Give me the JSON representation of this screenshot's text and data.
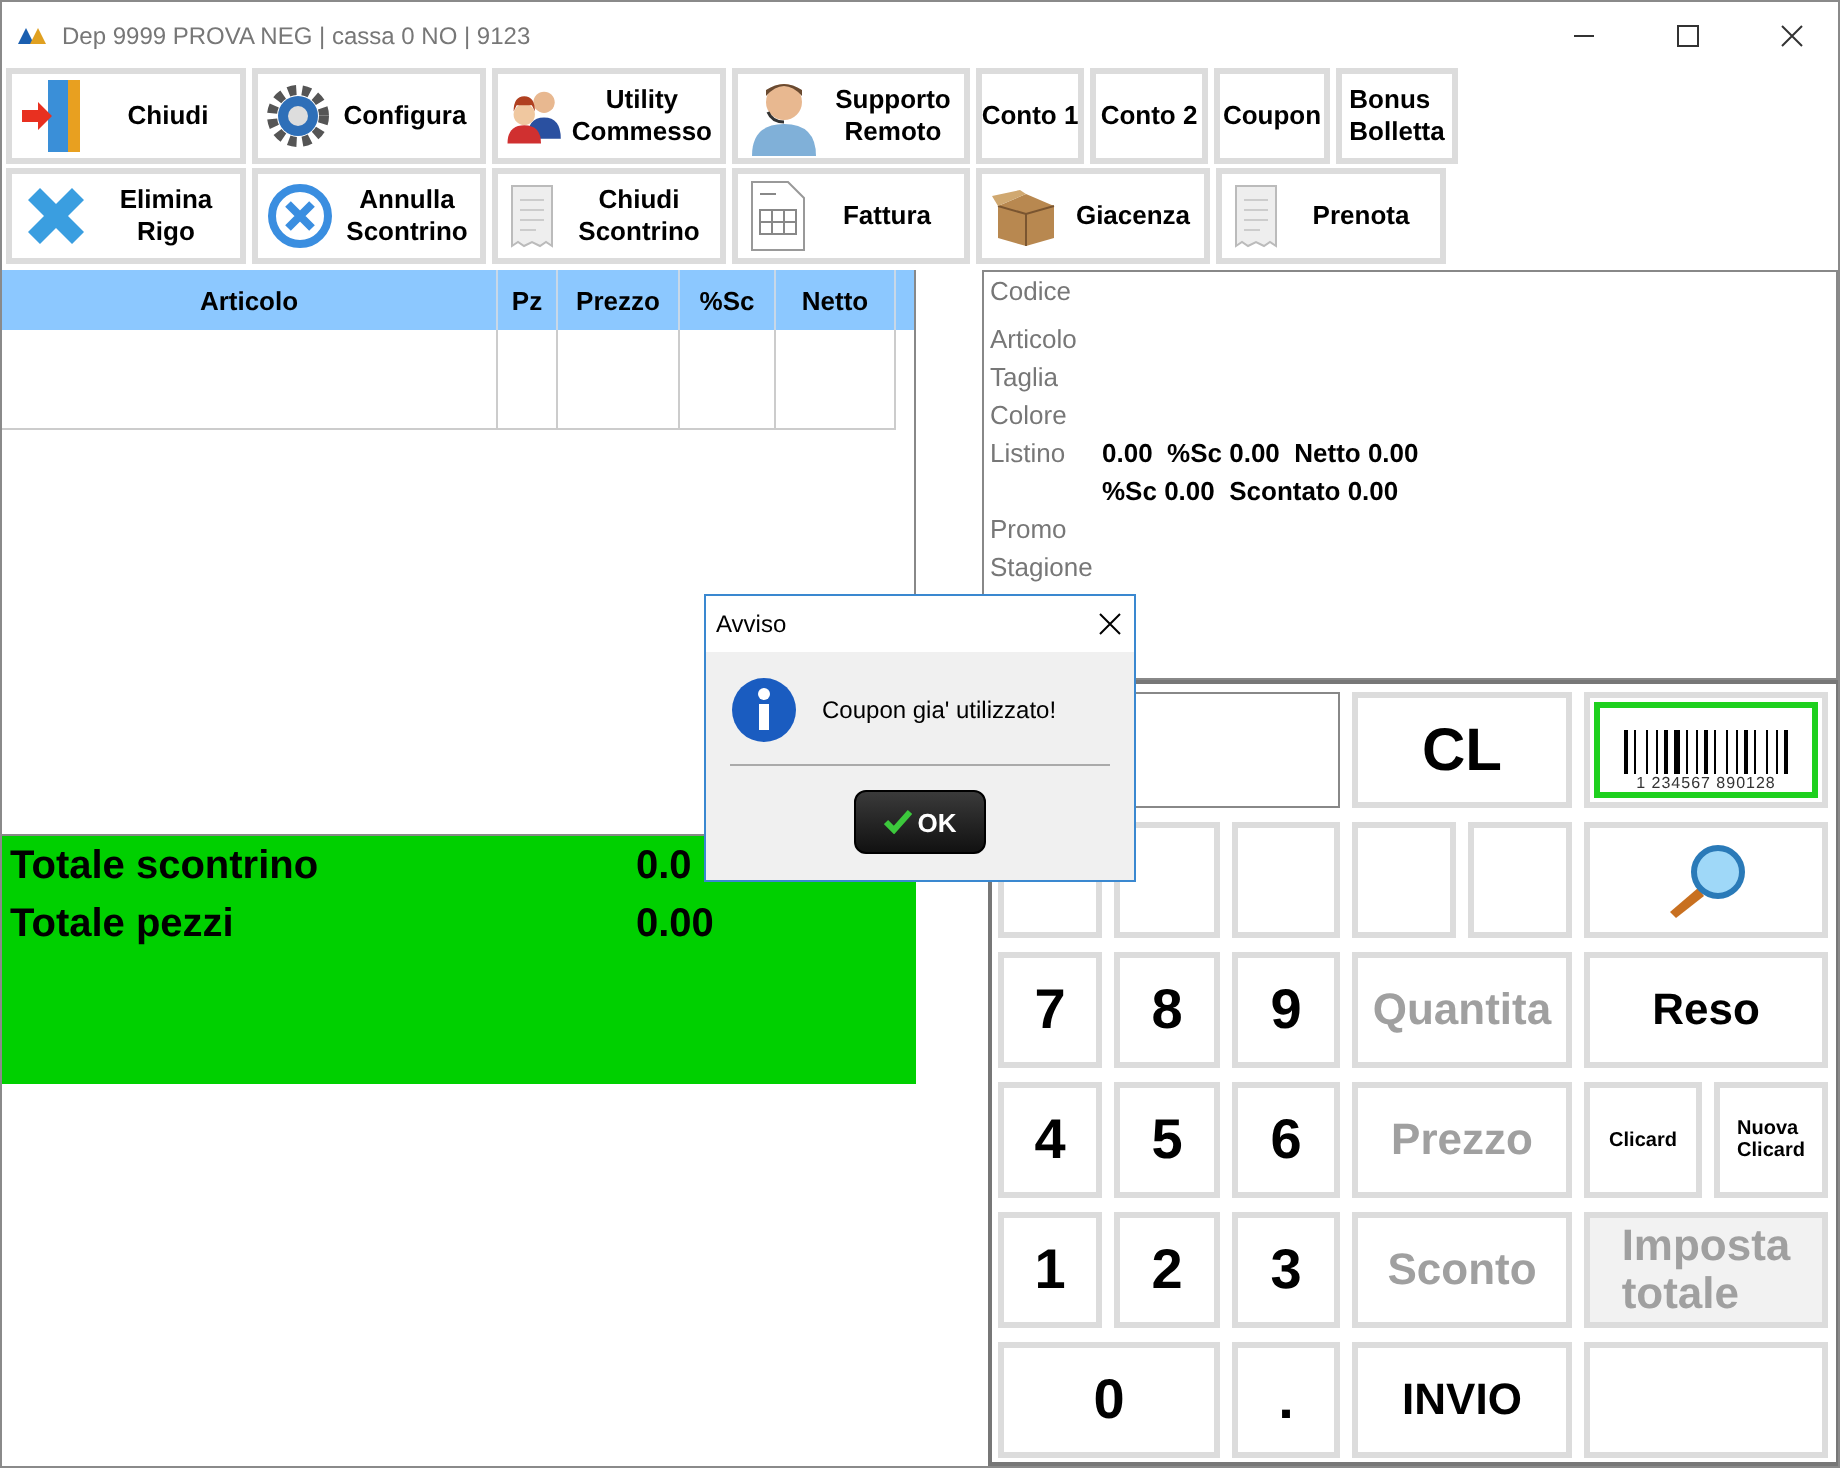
{
  "window": {
    "title": "Dep 9999 PROVA NEG | cassa 0 NO  | 9123"
  },
  "toolbar_rows": [
    [
      {
        "label": "Chiudi"
      },
      {
        "label": "Configura"
      },
      {
        "label": "Utility\nCommesso"
      },
      {
        "label": "Supporto\nRemoto"
      },
      {
        "label": "Conto 1"
      },
      {
        "label": "Conto 2"
      },
      {
        "label": "Coupon"
      },
      {
        "label": "Bonus\nBolletta"
      }
    ],
    [
      {
        "label": "Elimina\nRigo"
      },
      {
        "label": "Annulla\nScontrino"
      },
      {
        "label": "Chiudi\nScontrino"
      },
      {
        "label": "Fattura"
      },
      {
        "label": "Giacenza"
      },
      {
        "label": "Prenota"
      }
    ]
  ],
  "table": {
    "columns": [
      "Articolo",
      "Pz",
      "Prezzo",
      "%Sc",
      "Netto"
    ]
  },
  "totals": [
    {
      "label": "Totale scontrino",
      "value": "0.0"
    },
    {
      "label": "Totale pezzi",
      "value": "0.00"
    }
  ],
  "article_info": [
    {
      "label": "Codice"
    },
    {
      "label": "Articolo"
    },
    {
      "label": "Taglia"
    },
    {
      "label": "Colore"
    },
    {
      "label": "Listino",
      "value": "0.00  %Sc 0.00  Netto 0.00"
    },
    {
      "value": "%Sc 0.00  Scontato 0.00"
    },
    {
      "label": "Promo"
    },
    {
      "label": "Stagione"
    }
  ],
  "keypad": [
    {
      "kind": "display"
    },
    {
      "kind": "command",
      "label": "CL",
      "disabled": false
    },
    {
      "kind": "barcode",
      "caption": "1  234567  890128"
    },
    {
      "kind": "blank"
    },
    {
      "kind": "blank"
    },
    {
      "kind": "blank"
    },
    {
      "kind": "blank"
    },
    {
      "kind": "blank"
    },
    {
      "kind": "search"
    },
    {
      "kind": "digit",
      "label": "7"
    },
    {
      "kind": "digit",
      "label": "8"
    },
    {
      "kind": "digit",
      "label": "9"
    },
    {
      "kind": "command",
      "label": "Quantita",
      "disabled": true
    },
    {
      "kind": "command",
      "label": "Reso",
      "disabled": false
    },
    {
      "kind": "digit",
      "label": "4"
    },
    {
      "kind": "digit",
      "label": "5"
    },
    {
      "kind": "digit",
      "label": "6"
    },
    {
      "kind": "command",
      "label": "Prezzo",
      "disabled": true
    },
    {
      "kind": "small",
      "label": "Clicard"
    },
    {
      "kind": "small",
      "label": "Nuova\nClicard"
    },
    {
      "kind": "digit",
      "label": "1"
    },
    {
      "kind": "digit",
      "label": "2"
    },
    {
      "kind": "digit",
      "label": "3"
    },
    {
      "kind": "command",
      "label": "Sconto",
      "disabled": true
    },
    {
      "kind": "command",
      "label": "Imposta\ntotale",
      "disabled": true
    },
    {
      "kind": "digit",
      "label": "0"
    },
    {
      "kind": "digit",
      "label": "."
    },
    {
      "kind": "command",
      "label": "INVIO",
      "disabled": false
    },
    {
      "kind": "blank"
    }
  ],
  "dialog": {
    "title": "Avviso",
    "message": "Coupon gia' utilizzato!",
    "button": "OK"
  }
}
